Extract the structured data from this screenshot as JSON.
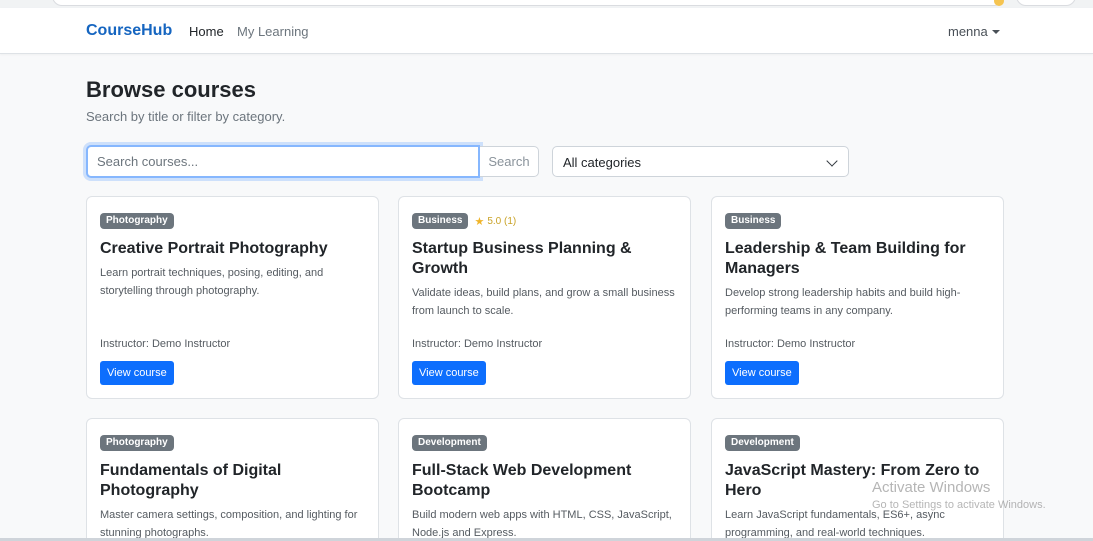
{
  "navbar": {
    "brand": "CourseHub",
    "links": [
      {
        "label": "Home"
      },
      {
        "label": "My Learning"
      }
    ],
    "user": "menna"
  },
  "page": {
    "title": "Browse courses",
    "subtitle": "Search by title or filter by category."
  },
  "search": {
    "placeholder": "Search courses...",
    "value": "",
    "button_label": "Search"
  },
  "filter": {
    "selected": "All categories"
  },
  "courses": [
    {
      "category": "Photography",
      "rating": "",
      "title": "Creative Portrait Photography",
      "description": "Learn portrait techniques, posing, editing, and storytelling through photography.",
      "instructor": "Instructor: Demo Instructor",
      "button": "View course"
    },
    {
      "category": "Business",
      "rating": "5.0 (1)",
      "title": "Startup Business Planning & Growth",
      "description": "Validate ideas, build plans, and grow a small business from launch to scale.",
      "instructor": "Instructor: Demo Instructor",
      "button": "View course"
    },
    {
      "category": "Business",
      "rating": "",
      "title": "Leadership & Team Building for Managers",
      "description": "Develop strong leadership habits and build high-performing teams in any company.",
      "instructor": "Instructor: Demo Instructor",
      "button": "View course"
    },
    {
      "category": "Photography",
      "rating": "",
      "title": "Fundamentals of Digital Photography",
      "description": "Master camera settings, composition, and lighting for stunning photographs.",
      "instructor": "",
      "button": ""
    },
    {
      "category": "Development",
      "rating": "",
      "title": "Full-Stack Web Development Bootcamp",
      "description": "Build modern web apps with HTML, CSS, JavaScript, Node.js and Express.",
      "instructor": "",
      "button": ""
    },
    {
      "category": "Development",
      "rating": "",
      "title": "JavaScript Mastery: From Zero to Hero",
      "description": "Learn JavaScript fundamentals, ES6+, async programming, and real-world techniques.",
      "instructor": "",
      "button": ""
    }
  ],
  "overlay": {
    "title": "Activate Windows",
    "subtitle": "Go to Settings to activate Windows."
  },
  "colors": {
    "brand": "#1565c0",
    "primary": "#0d6efd",
    "badge": "#6c757d",
    "star": "#f0b429"
  },
  "icons": {
    "user_menu": "caret-down-icon",
    "select": "chevron-down-icon",
    "rating": "star-icon"
  }
}
